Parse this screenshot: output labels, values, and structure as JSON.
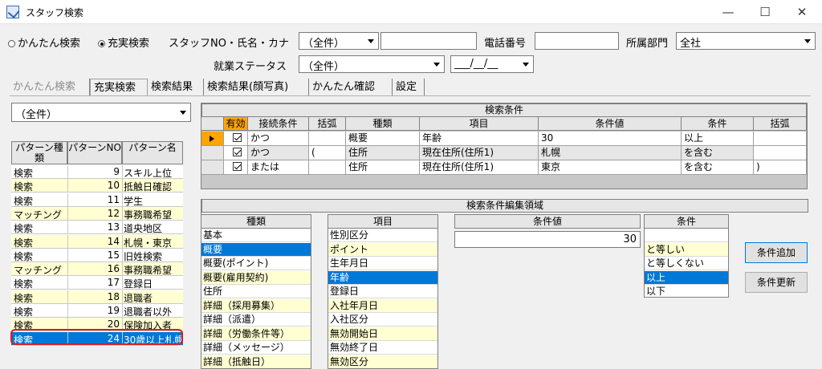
{
  "window": {
    "title": "スタッフ検索",
    "minimize": "—",
    "maximize": "☐",
    "close": "✕"
  },
  "search": {
    "mode_simple": "かんたん検索",
    "mode_full": "充実検索",
    "staff_label": "スタッフNO・氏名・カナ",
    "staff_combo": "（全件）",
    "staff_text": "",
    "phone_label": "電話番号",
    "phone_value": "",
    "dept_label": "所属部門",
    "dept_value": "全社",
    "status_label": "就業ステータス",
    "status_value": "（全件）",
    "date_value": "___/__/__"
  },
  "tabs": [
    {
      "label": "かんたん検索"
    },
    {
      "label": "充実検索"
    },
    {
      "label": "検索結果"
    },
    {
      "label": "検索結果(顔写真)"
    },
    {
      "label": "かんたん確認"
    },
    {
      "label": "設定"
    }
  ],
  "pattern_filter": "（全件）",
  "pattern_table": {
    "headers": [
      "パターン種類",
      "パターンNO",
      "パターン名"
    ],
    "rows": [
      {
        "type": "検索",
        "no": "9",
        "name": "スキル上位"
      },
      {
        "type": "検索",
        "no": "10",
        "name": "抵触日確認"
      },
      {
        "type": "検索",
        "no": "11",
        "name": "学生"
      },
      {
        "type": "マッチング",
        "no": "12",
        "name": "事務職希望"
      },
      {
        "type": "検索",
        "no": "13",
        "name": "道央地区"
      },
      {
        "type": "検索",
        "no": "14",
        "name": "札幌・東京"
      },
      {
        "type": "検索",
        "no": "15",
        "name": "旧姓検索"
      },
      {
        "type": "マッチング",
        "no": "16",
        "name": "事務職希望"
      },
      {
        "type": "検索",
        "no": "17",
        "name": "登録日"
      },
      {
        "type": "検索",
        "no": "18",
        "name": "退職者"
      },
      {
        "type": "検索",
        "no": "19",
        "name": "退職者以外"
      },
      {
        "type": "検索",
        "no": "20",
        "name": "保険加入者"
      },
      {
        "type": "検索",
        "no": "24",
        "name": "30歳以上札幌"
      }
    ]
  },
  "conditions": {
    "title": "検索条件",
    "headers": [
      "有効",
      "接続条件",
      "括弧",
      "種類",
      "項目",
      "条件値",
      "条件",
      "括弧"
    ],
    "rows": [
      {
        "conn": "かつ",
        "open": "",
        "kind": "概要",
        "item": "年齢",
        "value": "30",
        "cond": "以上",
        "close": ""
      },
      {
        "conn": "かつ",
        "open": "(",
        "kind": "住所",
        "item": "現在住所(住所1)",
        "value": "札幌",
        "cond": "を含む",
        "close": ""
      },
      {
        "conn": "または",
        "open": "",
        "kind": "住所",
        "item": "現在住所(住所1)",
        "value": "東京",
        "cond": "を含む",
        "close": ")"
      }
    ]
  },
  "edit": {
    "title": "検索条件編集領域",
    "kind_header": "種類",
    "kinds": [
      "基本",
      "概要",
      "概要(ポイント)",
      "概要(雇用契約)",
      "住所",
      "詳細（採用募集）",
      "詳細（派遣）",
      "詳細（労働条件等）",
      "詳細（メッセージ）",
      "詳細（抵触日）"
    ],
    "item_header": "項目",
    "items": [
      "性別区分",
      "ポイント",
      "生年月日",
      "年齢",
      "登録日",
      "入社年月日",
      "入社区分",
      "無効開始日",
      "無効終了日",
      "無効区分"
    ],
    "value_header": "条件値",
    "value": "30",
    "cond_header": "条件",
    "conds": [
      "",
      "と等しい",
      "と等しくない",
      "以上",
      "以下"
    ],
    "add_button": "条件追加",
    "update_button": "条件更新"
  }
}
